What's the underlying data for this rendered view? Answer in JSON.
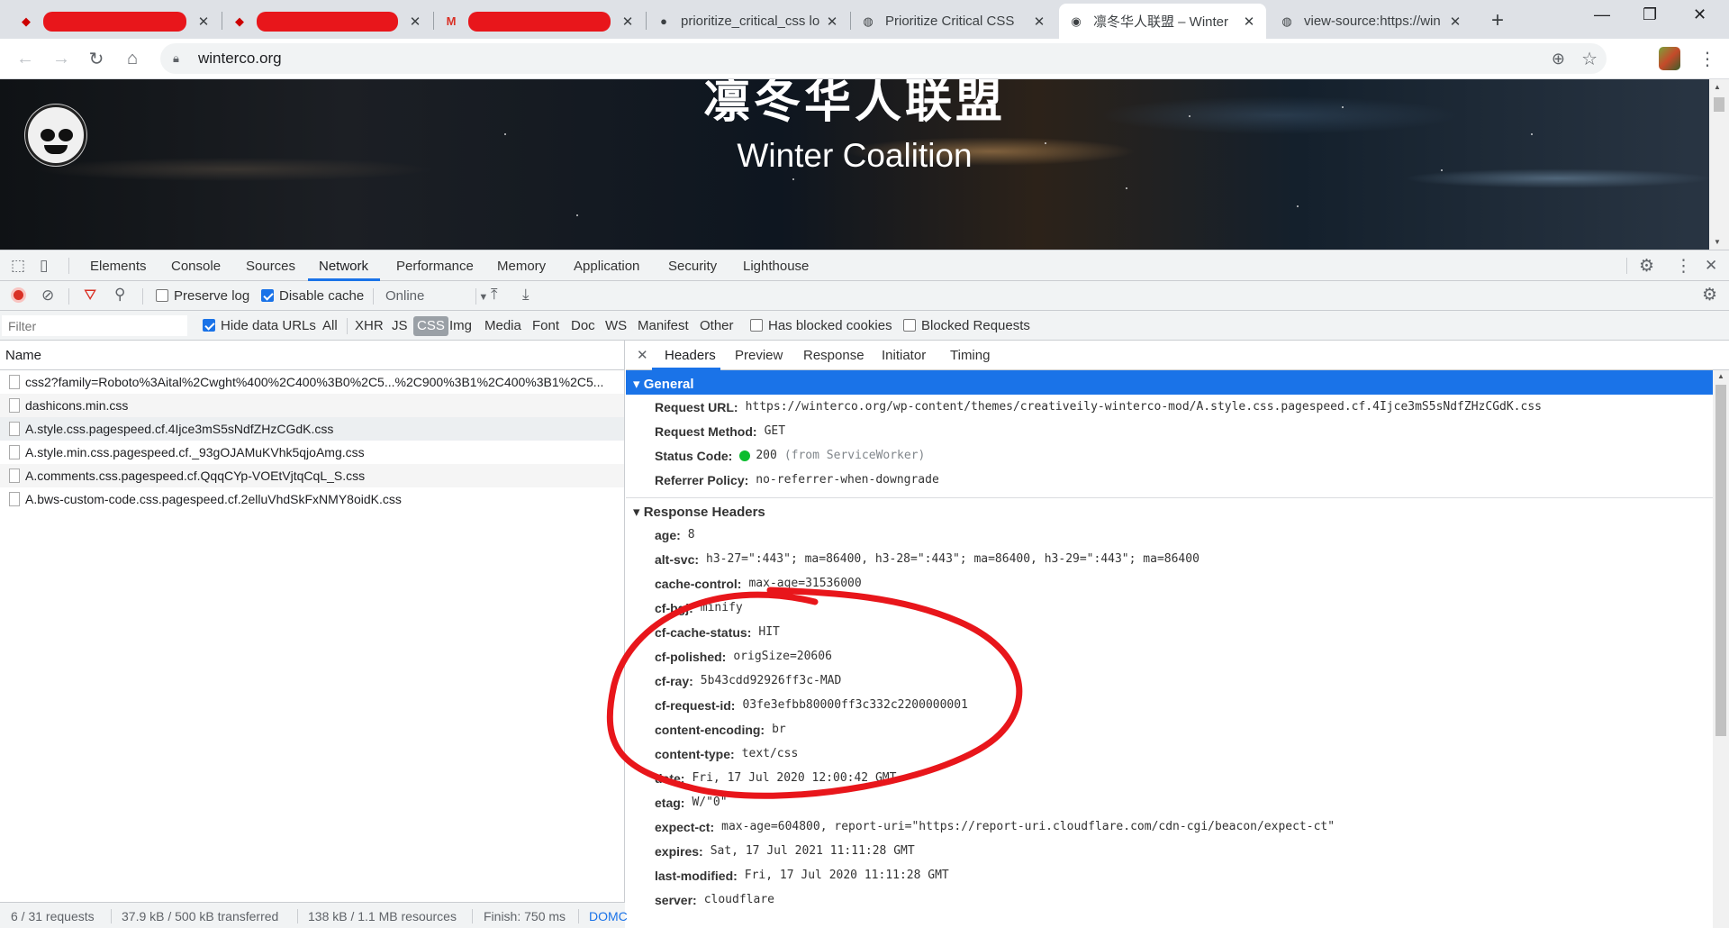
{
  "tabs": [
    {
      "title": "",
      "redacted": true
    },
    {
      "title": "",
      "redacted": true
    },
    {
      "title": "",
      "redacted": true
    },
    {
      "title": "prioritize_critical_css lo"
    },
    {
      "title": "Prioritize Critical CSS"
    },
    {
      "title": "凛冬华人联盟 – Winter"
    },
    {
      "title": "view-source:https://win"
    }
  ],
  "omnibox": {
    "url": "winterco.org"
  },
  "hero": {
    "title_cn": "凛冬华人联盟",
    "title_en": "Winter Coalition"
  },
  "devtools": {
    "tabs": [
      "Elements",
      "Console",
      "Sources",
      "Network",
      "Performance",
      "Memory",
      "Application",
      "Security",
      "Lighthouse"
    ],
    "active_tab": "Network",
    "toolbar": {
      "preserve_log": "Preserve log",
      "disable_cache": "Disable cache",
      "throttle": "Online"
    },
    "filter": {
      "placeholder": "Filter",
      "hide_data_urls": "Hide data URLs",
      "types": [
        "All",
        "XHR",
        "JS",
        "CSS",
        "Img",
        "Media",
        "Font",
        "Doc",
        "WS",
        "Manifest",
        "Other"
      ],
      "selected_type": "CSS",
      "has_blocked_cookies": "Has blocked cookies",
      "blocked_requests": "Blocked Requests"
    },
    "requests": {
      "column": "Name",
      "rows": [
        "css2?family=Roboto%3Aital%2Cwght%400%2C400%3B0%2C5...%2C900%3B1%2C400%3B1%2C5...",
        "dashicons.min.css",
        "A.style.css.pagespeed.cf.4Ijce3mS5sNdfZHzCGdK.css",
        "A.style.min.css.pagespeed.cf._93gOJAMuKVhk5qjoAmg.css",
        "A.comments.css.pagespeed.cf.QqqCYp-VOEtVjtqCqL_S.css",
        "A.bws-custom-code.css.pagespeed.cf.2elluVhdSkFxNMY8oidK.css"
      ],
      "status": {
        "requests": "6 / 31 requests",
        "transferred": "37.9 kB / 500 kB transferred",
        "resources": "138 kB / 1.1 MB resources",
        "finish": "Finish: 750 ms",
        "dom": "DOMC"
      }
    },
    "detail": {
      "tabs": [
        "Headers",
        "Preview",
        "Response",
        "Initiator",
        "Timing"
      ],
      "general_title": "General",
      "general": [
        {
          "k": "Request URL:",
          "v": "https://winterco.org/wp-content/themes/creativeily-winterco-mod/A.style.css.pagespeed.cf.4Ijce3mS5sNdfZHzCGdK.css"
        },
        {
          "k": "Request Method:",
          "v": "GET"
        },
        {
          "k": "Status Code:",
          "v": "200",
          "extra": "(from ServiceWorker)"
        },
        {
          "k": "Referrer Policy:",
          "v": "no-referrer-when-downgrade"
        }
      ],
      "response_title": "Response Headers",
      "response": [
        {
          "k": "age:",
          "v": "8"
        },
        {
          "k": "alt-svc:",
          "v": "h3-27=\":443\"; ma=86400, h3-28=\":443\"; ma=86400, h3-29=\":443\"; ma=86400"
        },
        {
          "k": "cache-control:",
          "v": "max-age=31536000"
        },
        {
          "k": "cf-bgj:",
          "v": "minify"
        },
        {
          "k": "cf-cache-status:",
          "v": "HIT"
        },
        {
          "k": "cf-polished:",
          "v": "origSize=20606"
        },
        {
          "k": "cf-ray:",
          "v": "5b43cdd92926ff3c-MAD"
        },
        {
          "k": "cf-request-id:",
          "v": "03fe3efbb80000ff3c332c2200000001"
        },
        {
          "k": "content-encoding:",
          "v": "br"
        },
        {
          "k": "content-type:",
          "v": "text/css"
        },
        {
          "k": "date:",
          "v": "Fri, 17 Jul 2020 12:00:42 GMT"
        },
        {
          "k": "etag:",
          "v": "W/\"0\""
        },
        {
          "k": "expect-ct:",
          "v": "max-age=604800, report-uri=\"https://report-uri.cloudflare.com/cdn-cgi/beacon/expect-ct\""
        },
        {
          "k": "expires:",
          "v": "Sat, 17 Jul 2021 11:11:28 GMT"
        },
        {
          "k": "last-modified:",
          "v": "Fri, 17 Jul 2020 11:11:28 GMT"
        },
        {
          "k": "server:",
          "v": "cloudflare"
        }
      ]
    }
  },
  "colors": {
    "accent": "#1a73e8",
    "annotation": "#e8161b",
    "status_ok": "#0bbd2e"
  }
}
